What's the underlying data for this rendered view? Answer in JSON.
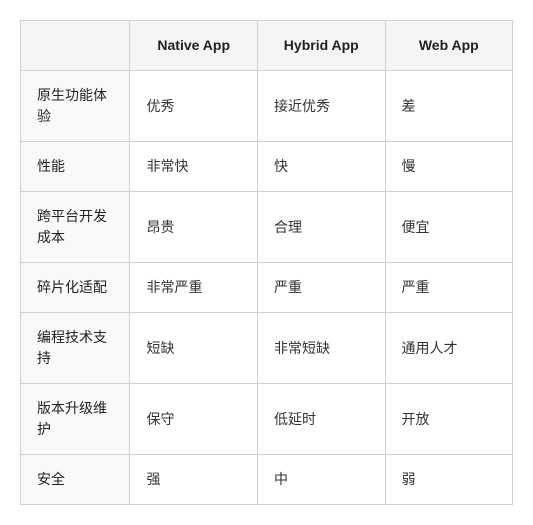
{
  "table": {
    "headers": [
      "",
      "Native App",
      "Hybrid App",
      "Web App"
    ],
    "rows": [
      {
        "feature": "原生功能体验",
        "native": "优秀",
        "hybrid": "接近优秀",
        "web": "差"
      },
      {
        "feature": "性能",
        "native": "非常快",
        "hybrid": "快",
        "web": "慢"
      },
      {
        "feature": "跨平台开发成本",
        "native": "昂贵",
        "hybrid": "合理",
        "web": "便宜"
      },
      {
        "feature": "碎片化适配",
        "native": "非常严重",
        "hybrid": "严重",
        "web": "严重"
      },
      {
        "feature": "编程技术支持",
        "native": "短缺",
        "hybrid": "非常短缺",
        "web": "通用人才"
      },
      {
        "feature": "版本升级维护",
        "native": "保守",
        "hybrid": "低延时",
        "web": "开放"
      },
      {
        "feature": "安全",
        "native": "强",
        "hybrid": "中",
        "web": "弱"
      }
    ]
  }
}
